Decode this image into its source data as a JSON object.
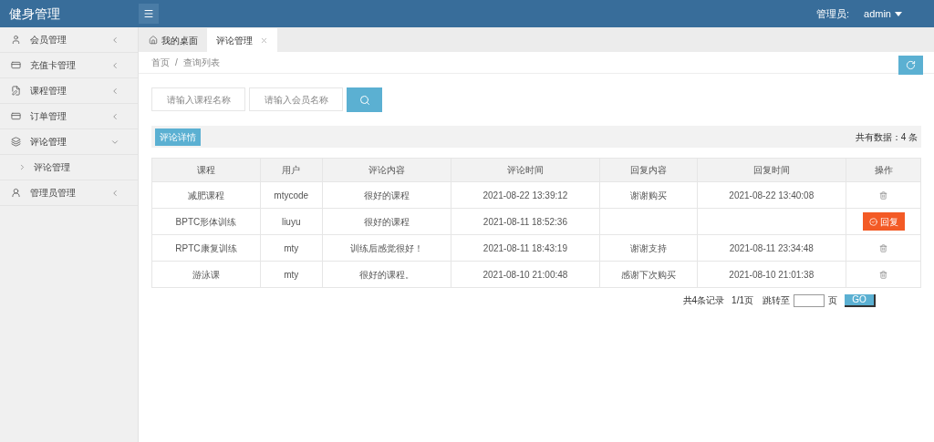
{
  "header": {
    "title": "健身管理",
    "admin_label": "管理员:",
    "admin_name": "admin"
  },
  "sidebar": {
    "items": [
      {
        "label": "会员管理",
        "expanded": false
      },
      {
        "label": "充值卡管理",
        "expanded": false
      },
      {
        "label": "课程管理",
        "expanded": false
      },
      {
        "label": "订单管理",
        "expanded": false
      },
      {
        "label": "评论管理",
        "expanded": true,
        "children": [
          {
            "label": "评论管理"
          }
        ]
      },
      {
        "label": "管理员管理",
        "expanded": false
      }
    ]
  },
  "tabs": [
    {
      "label": "我的桌面",
      "kind": "home",
      "selected": false
    },
    {
      "label": "评论管理",
      "kind": "closable",
      "selected": true
    }
  ],
  "breadcrumb": {
    "items": [
      "首页",
      "查询列表"
    ],
    "separator": "/"
  },
  "search": {
    "fields": [
      {
        "placeholder": "请输入课程名称"
      },
      {
        "placeholder": "请输入会员名称"
      }
    ]
  },
  "toolbar": {
    "button": "评论详情",
    "total": "共有数据：4 条"
  },
  "table": {
    "columns": [
      "课程",
      "用户",
      "评论内容",
      "评论时间",
      "回复内容",
      "回复时间",
      "操作"
    ],
    "rows": [
      {
        "cells": [
          "减肥课程",
          "mtycode",
          "很好的课程",
          "2021-08-22 13:39:12",
          "谢谢购买",
          "2021-08-22 13:40:08"
        ],
        "action": {
          "kind": "delete"
        }
      },
      {
        "cells": [
          "BPTC形体训练",
          "liuyu",
          "很好的课程",
          "2021-08-11 18:52:36",
          "",
          ""
        ],
        "action": {
          "kind": "reply",
          "label": "回复"
        }
      },
      {
        "cells": [
          "RPTC康复训练",
          "mty",
          "训练后感觉很好！",
          "2021-08-11 18:43:19",
          "谢谢支持",
          "2021-08-11 23:34:48"
        ],
        "action": {
          "kind": "delete"
        }
      },
      {
        "cells": [
          "游泳课",
          "mty",
          "很好的课程。",
          "2021-08-10 21:00:48",
          "感谢下次购买",
          "2021-08-10 21:01:38"
        ],
        "action": {
          "kind": "delete"
        }
      }
    ]
  },
  "pagination": {
    "records": "共4条记录",
    "pages": "1/1页",
    "jump_label": "跳转至",
    "page_unit": "页",
    "go": "GO"
  }
}
